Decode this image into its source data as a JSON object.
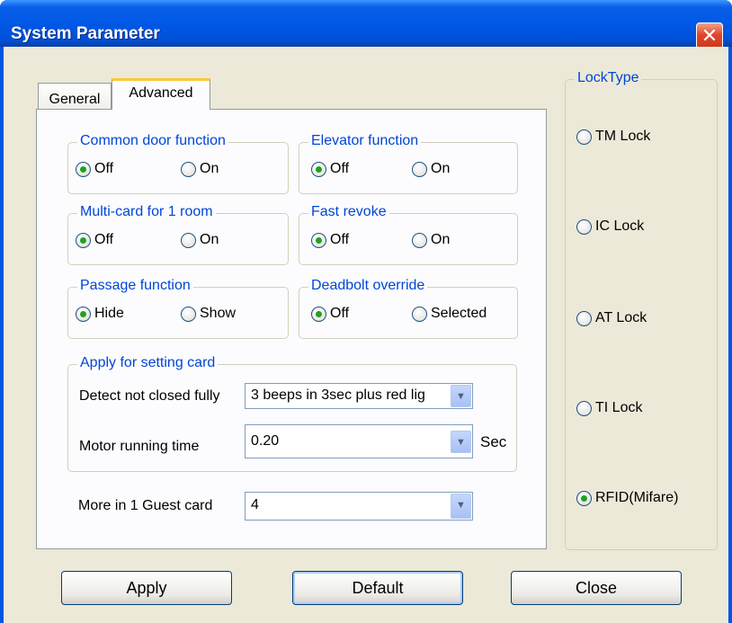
{
  "window": {
    "title": "System Parameter",
    "close_symbol": "✕"
  },
  "tabs": [
    {
      "label": "General",
      "selected": false
    },
    {
      "label": "Advanced",
      "selected": true
    }
  ],
  "groups": {
    "common_door": {
      "label": "Common door function",
      "options": [
        "Off",
        "On"
      ],
      "selected": "Off"
    },
    "elevator": {
      "label": "Elevator function",
      "options": [
        "Off",
        "On"
      ],
      "selected": "Off"
    },
    "multi_card": {
      "label": "Multi-card for 1 room",
      "options": [
        "Off",
        "On"
      ],
      "selected": "Off"
    },
    "fast_revoke": {
      "label": "Fast revoke",
      "options": [
        "Off",
        "On"
      ],
      "selected": "Off"
    },
    "passage": {
      "label": "Passage function",
      "options": [
        "Hide",
        "Show"
      ],
      "selected": "Hide"
    },
    "deadbolt": {
      "label": "Deadbolt override",
      "options": [
        "Off",
        "Selected"
      ],
      "selected": "Off"
    }
  },
  "setting_card": {
    "label": "Apply for setting card",
    "detect_label": "Detect not closed fully",
    "detect_value": "3 beeps in 3sec plus red lig",
    "motor_label": "Motor running time",
    "motor_value": "0.20",
    "motor_unit": "Sec"
  },
  "guest_card": {
    "label": "More in 1 Guest card",
    "value": "4"
  },
  "lock_type": {
    "label": "LockType",
    "options": [
      "TM Lock",
      "IC Lock",
      "AT Lock",
      "TI Lock",
      "RFID(Mifare)"
    ],
    "selected": "RFID(Mifare)"
  },
  "buttons": {
    "apply": "Apply",
    "default": "Default",
    "close": "Close"
  },
  "icons": {
    "dropdown": "chevron-down-icon"
  },
  "colors": {
    "titlebar": "#0055e5",
    "dialog_bg": "#ece9d8",
    "group_label": "#0046d5",
    "radio_selected": "#21a121"
  }
}
